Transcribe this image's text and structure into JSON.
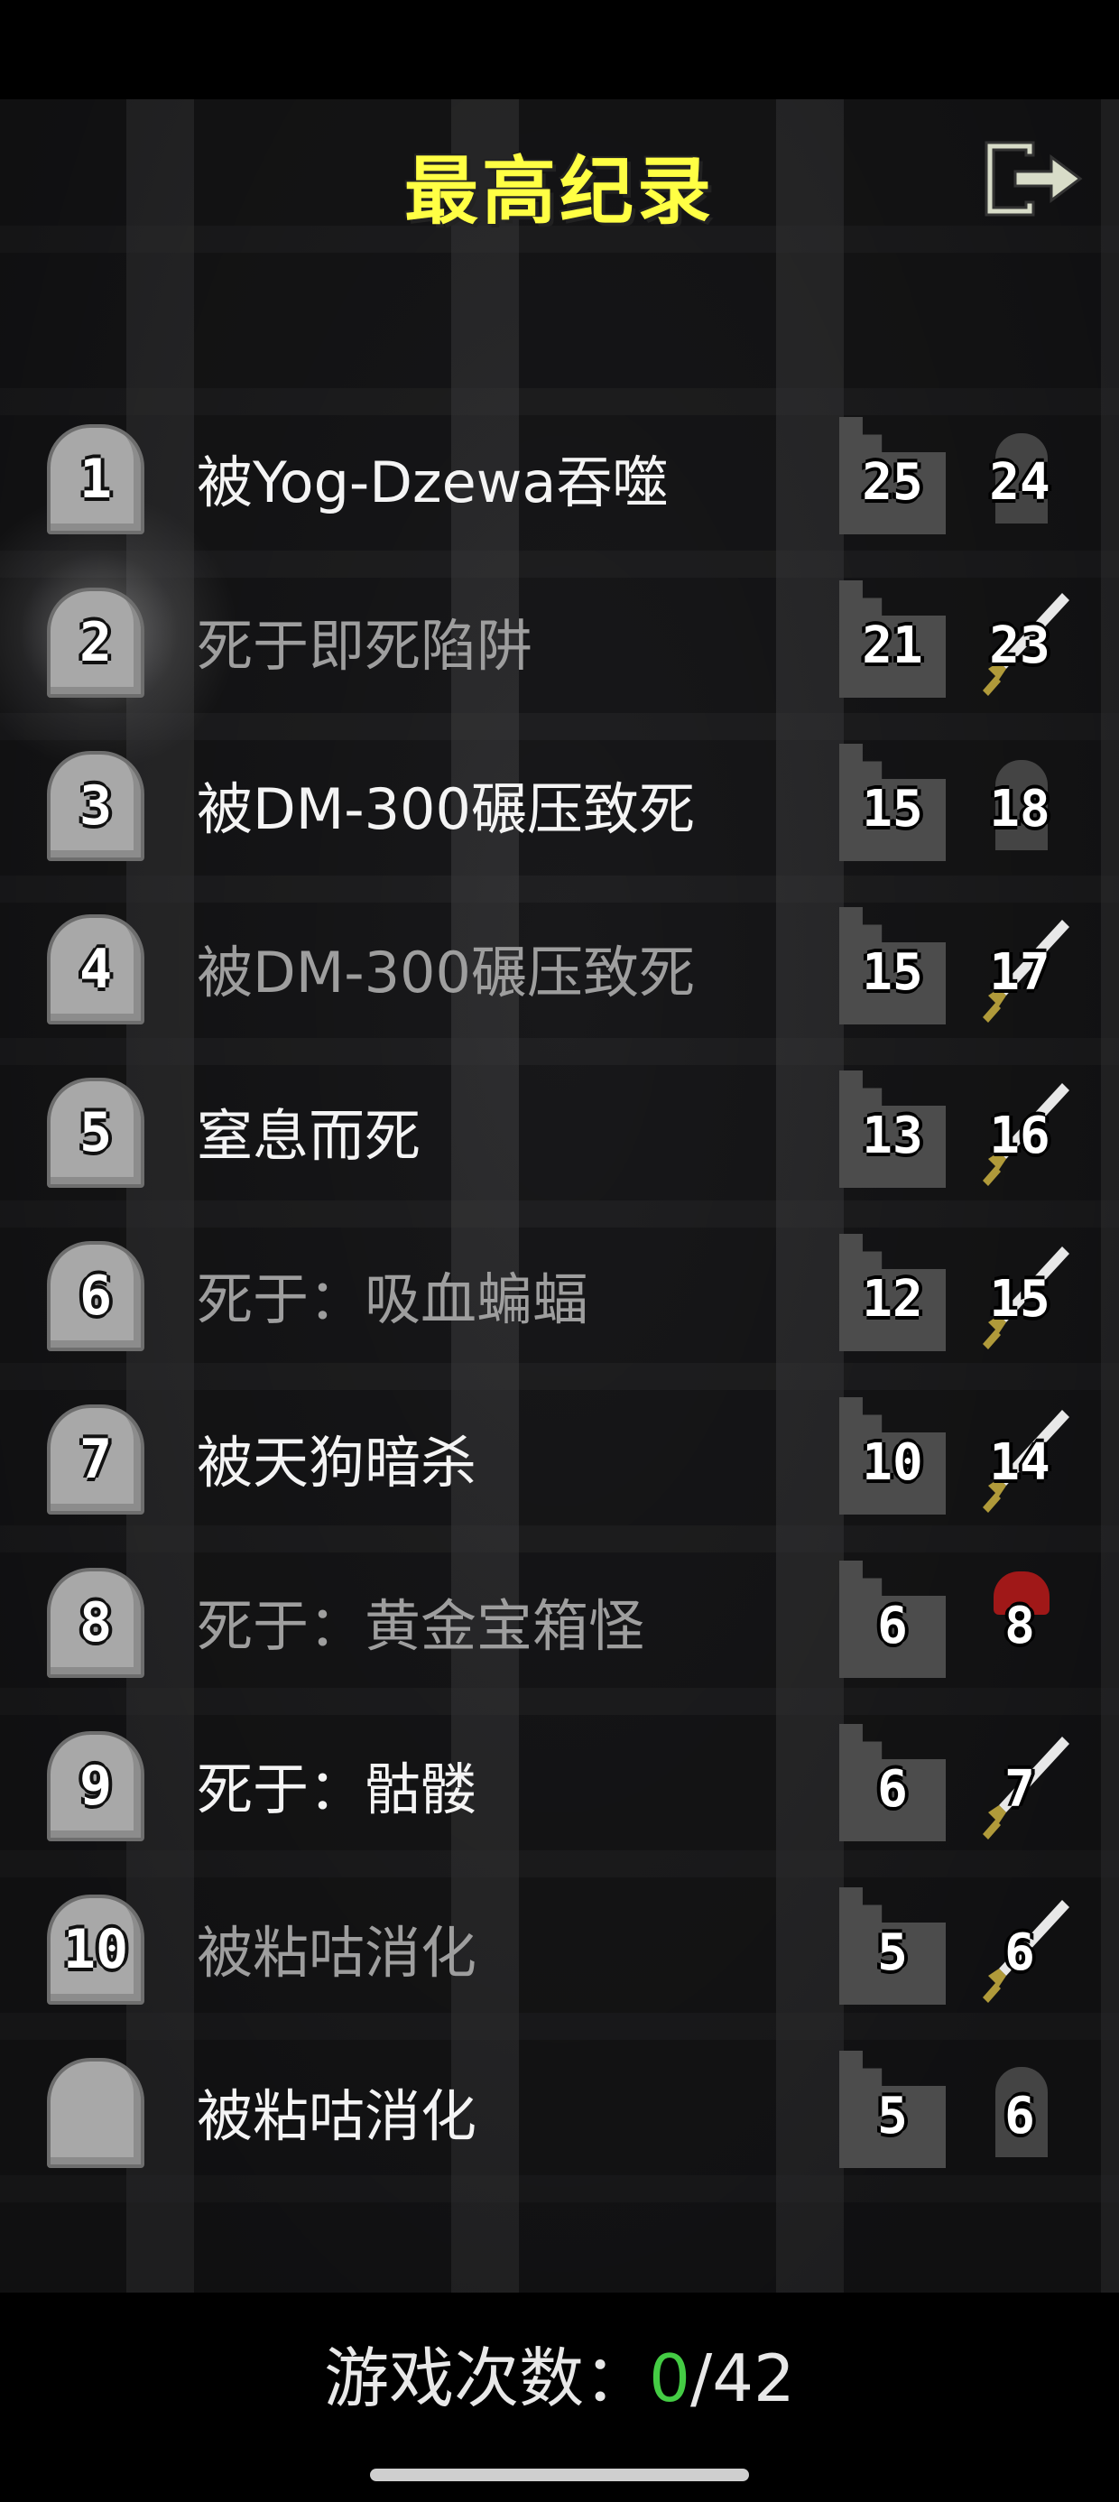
{
  "title": "最高纪录",
  "exit_icon": "exit-door-icon",
  "records": [
    {
      "rank": "1",
      "cause": "被Yog-Dzewa吞噬",
      "depth": "25",
      "level": "24",
      "bright": true,
      "badge": "helm"
    },
    {
      "rank": "2",
      "cause": "死于即死陷阱",
      "depth": "21",
      "level": "23",
      "bright": false,
      "badge": "sword"
    },
    {
      "rank": "3",
      "cause": "被DM-300碾压致死",
      "depth": "15",
      "level": "18",
      "bright": true,
      "badge": "helm"
    },
    {
      "rank": "4",
      "cause": "被DM-300碾压致死",
      "depth": "15",
      "level": "17",
      "bright": false,
      "badge": "sword"
    },
    {
      "rank": "5",
      "cause": "窒息而死",
      "depth": "13",
      "level": "16",
      "bright": true,
      "badge": "sword"
    },
    {
      "rank": "6",
      "cause": "死于：吸血蝙蝠",
      "depth": "12",
      "level": "15",
      "bright": false,
      "badge": "sword"
    },
    {
      "rank": "7",
      "cause": "被天狗暗杀",
      "depth": "10",
      "level": "14",
      "bright": true,
      "badge": "sword"
    },
    {
      "rank": "8",
      "cause": "死于：黄金宝箱怪",
      "depth": "6",
      "level": "8",
      "bright": false,
      "badge": "redhelm"
    },
    {
      "rank": "9",
      "cause": "死于：骷髅",
      "depth": "6",
      "level": "7",
      "bright": true,
      "badge": "sword"
    },
    {
      "rank": "10",
      "cause": "被粘咕消化",
      "depth": "5",
      "level": "6",
      "bright": false,
      "badge": "sword"
    },
    {
      "rank": "",
      "cause": "被粘咕消化",
      "depth": "5",
      "level": "6",
      "bright": true,
      "badge": "helm"
    }
  ],
  "footer": {
    "label": "游戏次数：",
    "current": "0",
    "total": "/42"
  }
}
